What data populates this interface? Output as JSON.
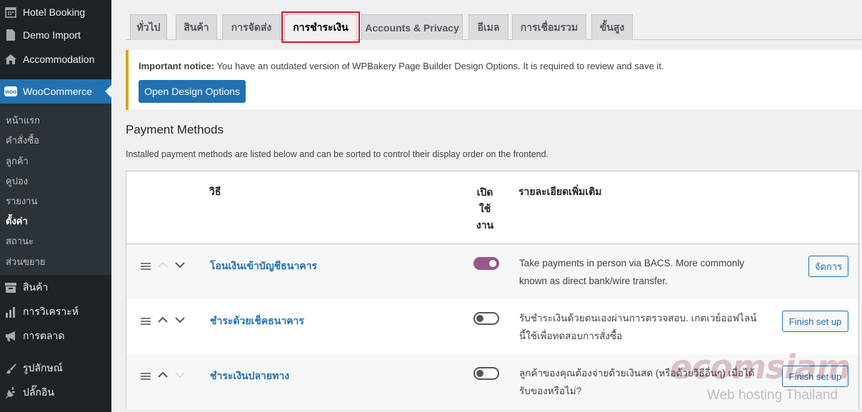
{
  "sidebar": {
    "items": [
      {
        "label": "Hotel Booking",
        "icon": "calendar-icon"
      },
      {
        "label": "Demo Import",
        "icon": "page-icon"
      },
      {
        "label": "Accommodation",
        "icon": "home-icon"
      },
      {
        "label": "WooCommerce",
        "icon": "woo-icon",
        "active": true,
        "badge": "woo"
      },
      {
        "label": "สินค้า",
        "icon": "archive-icon"
      },
      {
        "label": "การวิเคราะห์",
        "icon": "bar-chart-icon"
      },
      {
        "label": "การตลาด",
        "icon": "megaphone-icon"
      },
      {
        "label": "รูปลักษณ์",
        "icon": "brush-icon"
      },
      {
        "label": "ปลั๊กอิน",
        "icon": "plug-icon"
      }
    ],
    "submenu": [
      "หน้าแรก",
      "คำสั่งซื้อ",
      "ลูกค้า",
      "คูปอง",
      "รายงาน",
      "ตั้งค่า",
      "สถานะ",
      "ส่วนขยาย"
    ],
    "submenu_current": "ตั้งค่า"
  },
  "tabs": [
    "ทั่วไป",
    "สินค้า",
    "การจัดส่ง",
    "การชำระเงิน",
    "Accounts & Privacy",
    "อีเมล",
    "การเชื่อมรวม",
    "ขั้นสูง"
  ],
  "tabs_active": "การชำระเงิน",
  "notice": {
    "strong": "Important notice:",
    "text": " You have an outdated version of WPBakery Page Builder Design Options. It is required to review and save it.",
    "button": "Open Design Options"
  },
  "section": {
    "title": "Payment Methods",
    "description": "Installed payment methods are listed below and can be sorted to control their display order on the frontend."
  },
  "table": {
    "headers": {
      "method": "วิธี",
      "enabled": "เปิดใช้งาน",
      "enabled_lines": [
        "เปิด",
        "ใช้",
        "งาน"
      ],
      "description": "รายละเอียดเพิ่มเติม"
    },
    "rows": [
      {
        "name": "โอนเงินเข้าบัญชีธนาคาร",
        "enabled": true,
        "description": "Take payments in person via BACS. More commonly known as direct bank/wire transfer.",
        "action": "จัดการ",
        "up_disabled": true,
        "down_disabled": false
      },
      {
        "name": "ชำระด้วยเช็คธนาคาร",
        "enabled": false,
        "description": "รับชำระเงินด้วยตนเองผ่านการตรวจสอบ. เกตเวย์ออฟไลน์นี้ใช้เพื่อทดสอบการสั่งซื้อ",
        "action": "Finish set up",
        "up_disabled": false,
        "down_disabled": false
      },
      {
        "name": "ชำระเงินปลายทาง",
        "enabled": false,
        "description": "ลูกค้าของคุณต้องจ่ายด้วยเงินสด (หรือด้วยวิธีอื่นๆ) เมื่อได้รับของหรือไม่?",
        "action": "Finish set up",
        "up_disabled": false,
        "down_disabled": true
      }
    ]
  },
  "watermark": {
    "logo": "ecomsiam",
    "tagline": "Web hosting Thailand"
  },
  "colors": {
    "sidebar_bg": "#1d2327",
    "accent": "#2271b1",
    "toggle_on": "#96588a",
    "notice_border": "#dba617",
    "highlight": "#e0141e"
  }
}
